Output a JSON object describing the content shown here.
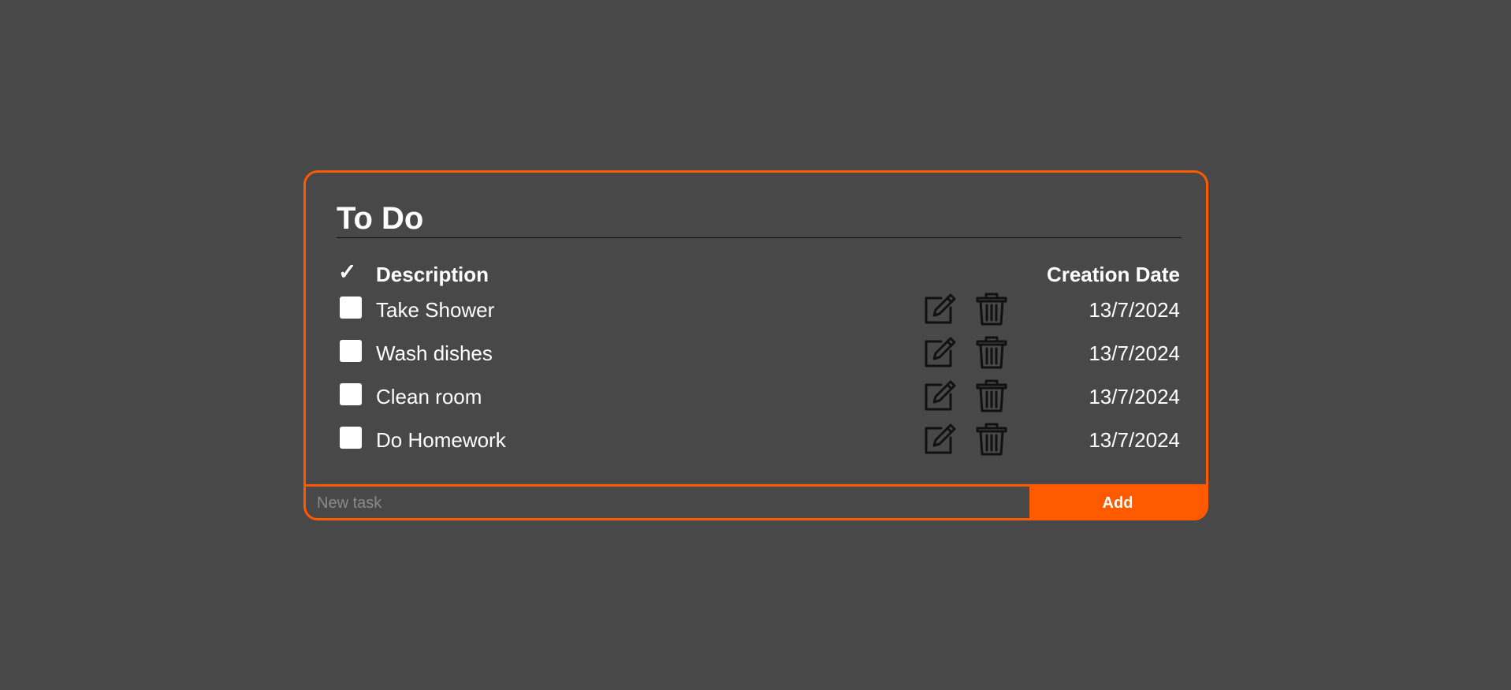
{
  "app": {
    "title": "To Do"
  },
  "table": {
    "check_header": "✓",
    "description_header": "Description",
    "date_header": "Creation Date"
  },
  "tasks": [
    {
      "description": "Take Shower",
      "date": "13/7/2024",
      "checked": false
    },
    {
      "description": "Wash dishes",
      "date": "13/7/2024",
      "checked": false
    },
    {
      "description": "Clean room",
      "date": "13/7/2024",
      "checked": false
    },
    {
      "description": "Do Homework",
      "date": "13/7/2024",
      "checked": false
    }
  ],
  "icons": {
    "edit": "pencil-square-icon",
    "delete": "trash-icon"
  },
  "footer": {
    "input_placeholder": "New task",
    "input_value": "",
    "add_label": "Add"
  },
  "colors": {
    "background": "#484848",
    "accent": "#ff5a00",
    "text": "#ffffff",
    "icon": "#111111"
  }
}
